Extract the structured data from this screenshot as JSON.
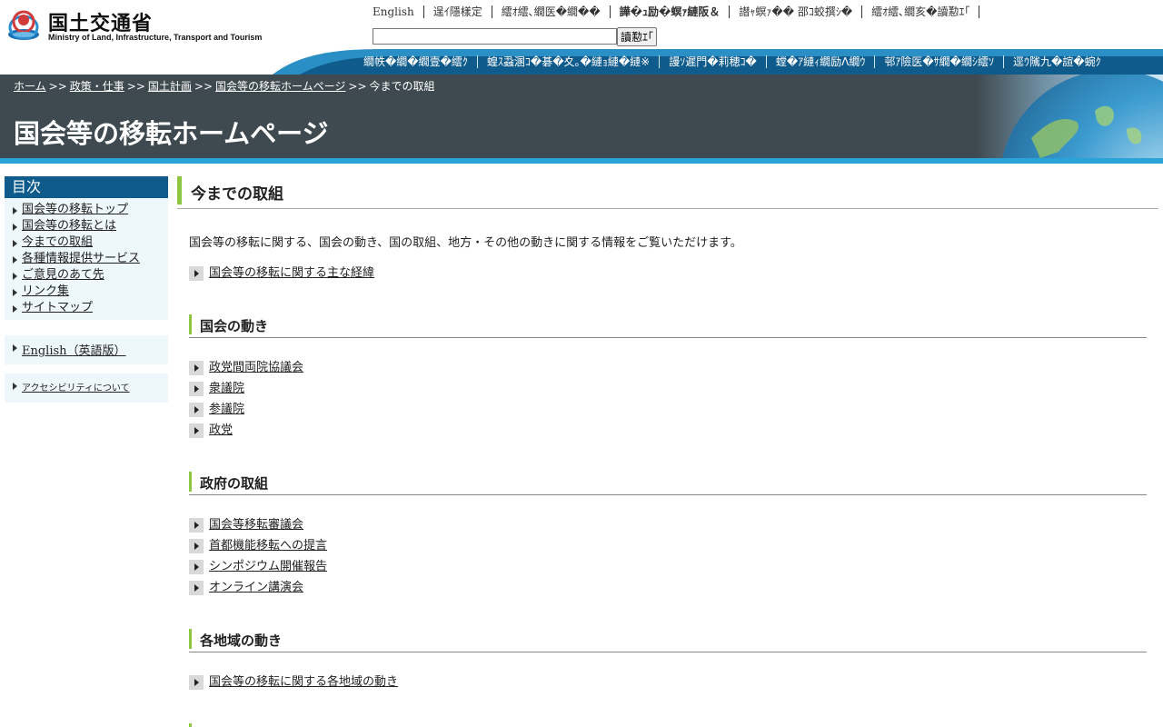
{
  "header": {
    "logo_jp": "国土交通省",
    "logo_en": "Ministry of Land, Infrastructure, Transport and Tourism",
    "util_links": [
      {
        "label": "English",
        "bold": false
      },
      {
        "label": "逞ｲ隱樣定",
        "bold": false
      },
      {
        "label": "繧ｵ繧､繝医�繝��",
        "bold": false
      },
      {
        "label": "譁�ｭ励�螟ｧ縺阪＆",
        "bold": true
      },
      {
        "label": "譛ｬ螟ｧ�� 邵ｺ蛟撰ｼ�",
        "bold": false
      },
      {
        "label": "繧ｵ繧､繝亥�讀懃ｴ｢",
        "bold": false
      }
    ],
    "search_button": "讀懃ｴ｢",
    "search_value": ""
  },
  "gnav": [
    "繝帙�繝�繝壹�繧ｸ",
    "蝗ｽ蝨溷ｺ�碁�夊｡�縺ｮ縺�縺※",
    "謾ｿ遲門�莉穂ｺ�",
    "螳�ｱ縺ｨ繝励Λ繝ｳ",
    "邨ｱ險医�ｻ繝�繝ｼ繧ｿ",
    "逕ｳ隲九�諠�蜿ｸ"
  ],
  "breadcrumb": {
    "items": [
      "ホーム",
      "政策・仕事",
      "国土計画",
      "国会等の移転ホームページ"
    ],
    "separator": ">>",
    "current": "今までの取組"
  },
  "page_title": "国会等の移転ホームページ",
  "sidebar": {
    "heading": "目次",
    "items": [
      "国会等の移転トップ",
      "国会等の移転とは",
      "今までの取組",
      "各種情報提供サービス",
      "ご意見のあて先",
      "リンク集",
      "サイトマップ"
    ],
    "english_link": "English（英語版）",
    "accessibility_link": "アクセシビリティについて"
  },
  "main": {
    "heading": "今までの取組",
    "intro": "国会等の移転に関する、国会の動き、国の取組、地方・その他の動きに関する情報をご覧いただけます。",
    "top_link": "国会等の移転に関する主な経緯",
    "sections": [
      {
        "title": "国会の動き",
        "links": [
          "政党間両院協議会",
          "衆議院",
          "参議院",
          "政党"
        ]
      },
      {
        "title": "政府の取組",
        "links": [
          "国会等移転審議会",
          "首都機能移転への提言",
          "シンポジウム開催報告",
          "オンライン講演会"
        ]
      },
      {
        "title": "各地域の動き",
        "links": [
          "国会等の移転に関する各地域の動き"
        ]
      }
    ]
  },
  "colors": {
    "banner_bg": "#3f4a50",
    "banner_bottom": "#29a3d8",
    "sidebar_head": "#0f5c8c",
    "sidebar_bg": "#eef7fb",
    "heading_accent": "#8dc63f",
    "gnav_bg": "#0f5c8c"
  }
}
